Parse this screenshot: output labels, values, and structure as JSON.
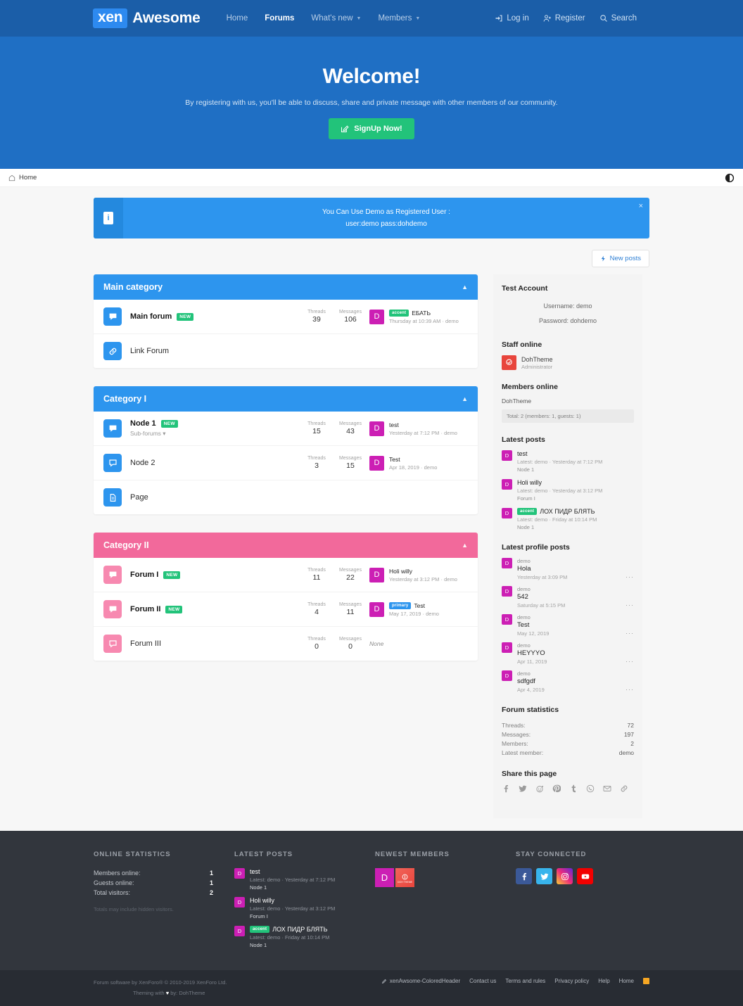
{
  "header": {
    "logo_xen": "xen",
    "logo_rest": "Awesome",
    "nav": [
      {
        "label": "Home",
        "active": false,
        "caret": false
      },
      {
        "label": "Forums",
        "active": true,
        "caret": false
      },
      {
        "label": "What's new",
        "active": false,
        "caret": true
      },
      {
        "label": "Members",
        "active": false,
        "caret": true
      }
    ],
    "user_nav": [
      {
        "label": "Log in",
        "icon": "login-icon"
      },
      {
        "label": "Register",
        "icon": "user-plus-icon"
      },
      {
        "label": "Search",
        "icon": "search-icon"
      }
    ]
  },
  "hero": {
    "title": "Welcome!",
    "subtitle": "By registering with us, you'll be able to discuss, share and private message with other members of our community.",
    "button": "SignUp Now!"
  },
  "breadcrumb": {
    "home": "Home",
    "mode_toggle": "dark-mode-toggle"
  },
  "notice": {
    "line1": "You Can Use Demo as Registered User :",
    "line2": "user:demo pass:dohdemo",
    "close": "×",
    "icon": "info-icon"
  },
  "toolbar": {
    "new_posts": "New posts"
  },
  "categories": [
    {
      "title": "Main category",
      "color": "#2d95ee",
      "icon_bg": "#2d95ee",
      "icon_fg": "#ffffff",
      "nodes": [
        {
          "name": "Main forum",
          "new": true,
          "icon": "forum-icon",
          "sub": null,
          "threads_label": "Threads",
          "threads": "39",
          "messages_label": "Messages",
          "messages": "106",
          "last": {
            "avatar": "D",
            "tag": "accent",
            "tag_text": "accent",
            "title": "ЕБАТЬ",
            "meta": "Thursday at 10:39 AM · demo"
          }
        },
        {
          "name": "Link Forum",
          "new": false,
          "icon": "link-icon",
          "sub": null,
          "threads_label": "",
          "threads": "",
          "messages_label": "",
          "messages": "",
          "last": null
        }
      ]
    },
    {
      "title": "Category I",
      "color": "#2d95ee",
      "icon_bg": "#2d95ee",
      "icon_fg": "#ffffff",
      "nodes": [
        {
          "name": "Node 1",
          "new": true,
          "icon": "forum-icon",
          "sub": "Sub-forums",
          "threads_label": "Threads",
          "threads": "15",
          "messages_label": "Messages",
          "messages": "43",
          "last": {
            "avatar": "D",
            "tag": null,
            "tag_text": "",
            "title": "test",
            "meta": "Yesterday at 7:12 PM · demo"
          }
        },
        {
          "name": "Node 2",
          "new": false,
          "icon": "forum-icon",
          "sub": null,
          "threads_label": "Threads",
          "threads": "3",
          "messages_label": "Messages",
          "messages": "15",
          "last": {
            "avatar": "D",
            "tag": null,
            "tag_text": "",
            "title": "Test",
            "meta": "Apr 18, 2019 · demo"
          }
        },
        {
          "name": "Page",
          "new": false,
          "icon": "page-icon",
          "sub": null,
          "threads_label": "",
          "threads": "",
          "messages_label": "",
          "messages": "",
          "last": null
        }
      ]
    },
    {
      "title": "Category II",
      "color": "#f2699b",
      "icon_bg": "#f789b0",
      "icon_fg": "#ffffff",
      "nodes": [
        {
          "name": "Forum I",
          "new": true,
          "icon": "forum-icon",
          "sub": null,
          "threads_label": "Threads",
          "threads": "11",
          "messages_label": "Messages",
          "messages": "22",
          "last": {
            "avatar": "D",
            "tag": null,
            "tag_text": "",
            "title": "Holi willy",
            "meta": "Yesterday at 3:12 PM · demo"
          }
        },
        {
          "name": "Forum II",
          "new": true,
          "icon": "forum-icon",
          "sub": null,
          "threads_label": "Threads",
          "threads": "4",
          "messages_label": "Messages",
          "messages": "11",
          "last": {
            "avatar": "D",
            "tag": "primary",
            "tag_text": "primary",
            "title": "Test",
            "meta": "May 17, 2019 · demo"
          }
        },
        {
          "name": "Forum III",
          "new": false,
          "icon": "forum-icon",
          "sub": null,
          "threads_label": "Threads",
          "threads": "0",
          "messages_label": "Messages",
          "messages": "0",
          "last": null,
          "last_none": "None"
        }
      ]
    }
  ],
  "sidebar": {
    "test_account": {
      "title": "Test Account",
      "username": "Username: demo",
      "password": "Password: dohdemo"
    },
    "staff_online": {
      "title": "Staff online",
      "name": "DohTheme",
      "role": "Administrator"
    },
    "members_online": {
      "title": "Members online",
      "names": "DohTheme",
      "total": "Total: 2 (members: 1, guests: 1)"
    },
    "latest_posts": {
      "title": "Latest posts",
      "items": [
        {
          "avatar": "D",
          "tag": null,
          "tag_text": "",
          "title": "test",
          "meta": "Latest: demo · Yesterday at 7:12 PM",
          "node": "Node 1"
        },
        {
          "avatar": "D",
          "tag": null,
          "tag_text": "",
          "title": "Holi willy",
          "meta": "Latest: demo · Yesterday at 3:12 PM",
          "node": "Forum I"
        },
        {
          "avatar": "D",
          "tag": "accent",
          "tag_text": "accent",
          "title": "ЛОХ ПИДР БЛЯТЬ",
          "meta": "Latest: demo · Friday at 10:14 PM",
          "node": "Node 1"
        }
      ]
    },
    "profile_posts": {
      "title": "Latest profile posts",
      "more": "···",
      "items": [
        {
          "avatar": "D",
          "user": "demo",
          "text": "Hola",
          "date": "Yesterday at 3:09 PM"
        },
        {
          "avatar": "D",
          "user": "demo",
          "text": "542",
          "date": "Saturday at 5:15 PM"
        },
        {
          "avatar": "D",
          "user": "demo",
          "text": "Test",
          "date": "May 12, 2019"
        },
        {
          "avatar": "D",
          "user": "demo",
          "text": "HEYYYO",
          "date": "Apr 11, 2019"
        },
        {
          "avatar": "D",
          "user": "demo",
          "text": "sdfgdf",
          "date": "Apr 4, 2019"
        }
      ]
    },
    "forum_statistics": {
      "title": "Forum statistics",
      "rows": [
        {
          "label": "Threads:",
          "value": "72"
        },
        {
          "label": "Messages:",
          "value": "197"
        },
        {
          "label": "Members:",
          "value": "2"
        },
        {
          "label": "Latest member:",
          "value": "demo"
        }
      ]
    },
    "share": {
      "title": "Share this page",
      "icons": [
        "facebook-icon",
        "twitter-icon",
        "reddit-icon",
        "pinterest-icon",
        "tumblr-icon",
        "whatsapp-icon",
        "email-icon",
        "link-icon"
      ]
    }
  },
  "footer": {
    "online_statistics": {
      "title": "ONLINE STATISTICS",
      "rows": [
        {
          "label": "Members online:",
          "value": "1"
        },
        {
          "label": "Guests online:",
          "value": "1"
        },
        {
          "label": "Total visitors:",
          "value": "2"
        }
      ],
      "note": "Totals may include hidden visitors."
    },
    "latest_posts": {
      "title": "LATEST POSTS",
      "items": [
        {
          "avatar": "D",
          "tag": null,
          "tag_text": "",
          "title": "test",
          "meta": "Latest: demo · Yesterday at 7:12 PM",
          "node": "Node 1"
        },
        {
          "avatar": "D",
          "tag": null,
          "tag_text": "",
          "title": "Holi willy",
          "meta": "Latest: demo · Yesterday at 3:12 PM",
          "node": "Forum I"
        },
        {
          "avatar": "D",
          "tag": "accent",
          "tag_text": "accent",
          "title": "ЛОХ ПИДР БЛЯТЬ",
          "meta": "Latest: demo · Friday at 10:14 PM",
          "node": "Node 1"
        }
      ]
    },
    "newest_members": {
      "title": "NEWEST MEMBERS",
      "members": [
        {
          "initial": "D",
          "label": ""
        },
        {
          "initial": "",
          "label": "DOH THEME"
        }
      ]
    },
    "stay_connected": {
      "title": "STAY CONNECTED",
      "links": [
        "facebook-icon",
        "twitter-icon",
        "instagram-icon",
        "youtube-icon"
      ]
    }
  },
  "copyright": {
    "line1": "Forum software by XenForo® © 2010-2019 XenForo Ltd.",
    "line2_pre": "Theming with ",
    "line2_heart": "♥",
    "line2_post": " by: DohTheme",
    "links": [
      {
        "label": "xenAwsome-ColoredHeader",
        "icon": "pencil-icon"
      },
      {
        "label": "Contact us",
        "icon": null
      },
      {
        "label": "Terms and rules",
        "icon": null
      },
      {
        "label": "Privacy policy",
        "icon": null
      },
      {
        "label": "Help",
        "icon": null
      },
      {
        "label": "Home",
        "icon": null
      }
    ],
    "rss": "rss-icon"
  }
}
